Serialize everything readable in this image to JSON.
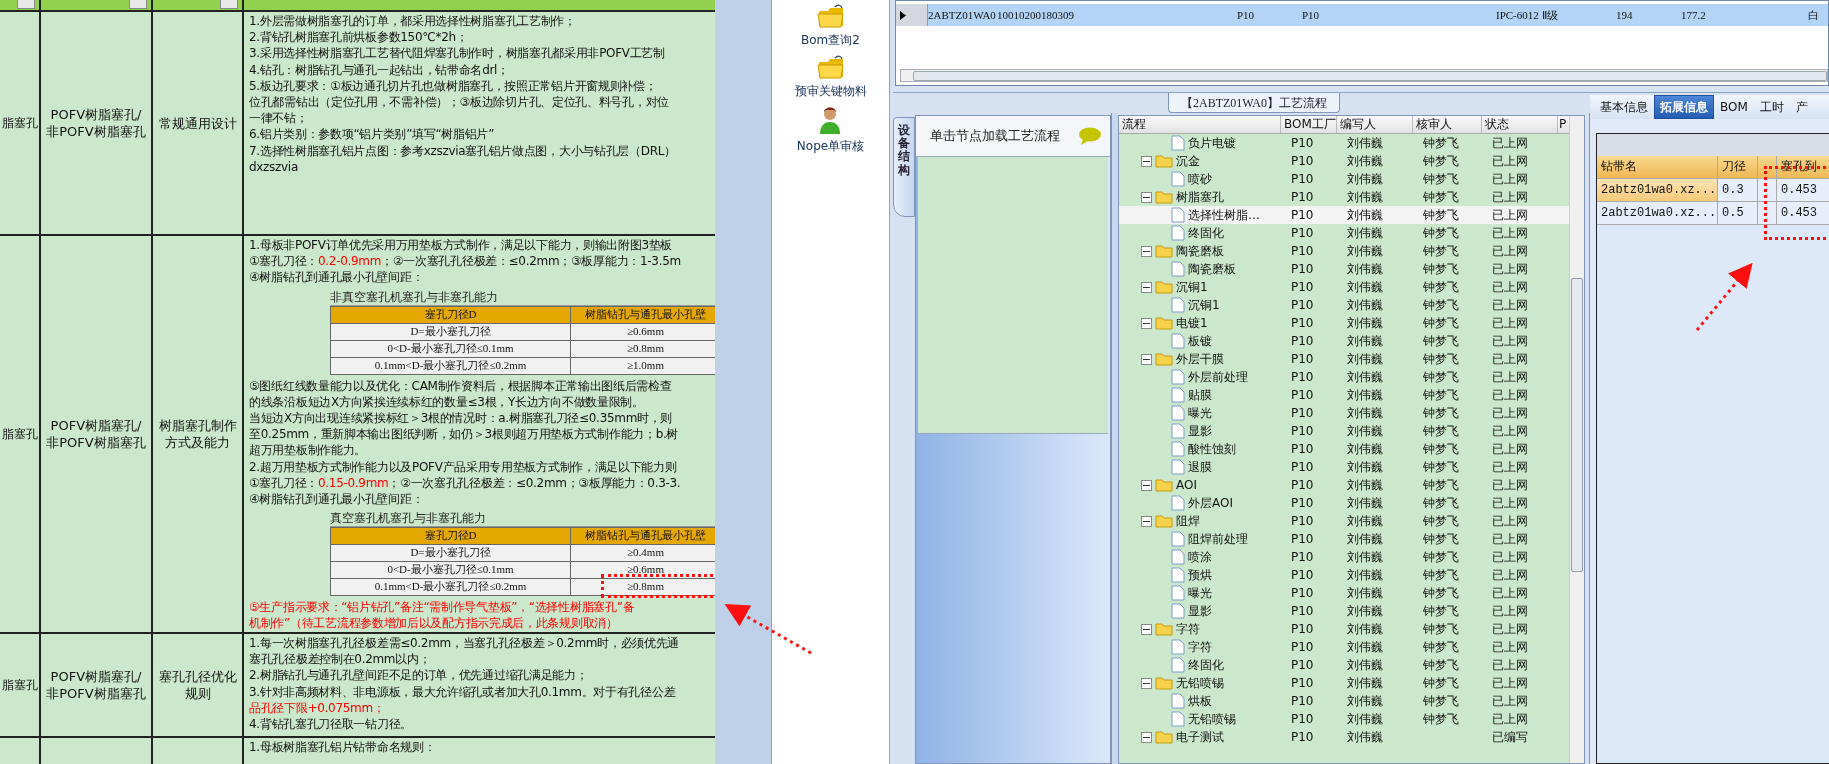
{
  "sheet": {
    "rows": [
      {
        "col1": "脂塞孔",
        "col2": "POFV树脂塞孔/非POFV树脂塞孔",
        "col3": "常规通用设计",
        "content": [
          {
            "kind": "line",
            "text": "1.外层需做树脂塞孔的订单，都采用选择性树脂塞孔工艺制作；",
            "red": false
          },
          {
            "kind": "line",
            "text": "2.背钻孔树脂塞孔前烘板参数150℃*2h；",
            "red": false
          },
          {
            "kind": "line",
            "text": "3.采用选择性树脂塞孔工艺替代阻焊塞孔制作时，树脂塞孔都采用非POFV工艺制",
            "red": false
          },
          {
            "kind": "line",
            "text": "4.钻孔：树脂钻孔与通孔一起钻出，钻带命名drl；",
            "red": false
          },
          {
            "kind": "line",
            "text": "5.板边孔要求：①板边通孔切片孔也做树脂塞孔，按照正常铝片开窗规则补偿；",
            "red": false
          },
          {
            "kind": "line",
            "text": "位孔都需钻出（定位孔用，不需补偿）；③板边除切片孔、定位孔、料号孔，对位",
            "red": false
          },
          {
            "kind": "line",
            "text": "一律不钻；",
            "red": false
          },
          {
            "kind": "line",
            "text": "6.铝片类别：参数项“铝片类别”填写“树脂铝片”",
            "red": false
          },
          {
            "kind": "line",
            "text": "7.选择性树脂塞孔铝片点图：参考xzszvia塞孔铝片做点图，大小与钻孔层（DRL）",
            "red": false
          },
          {
            "kind": "line",
            "text": "dxzszvia",
            "red": false
          }
        ]
      },
      {
        "col1": "脂塞孔",
        "col2": "POFV树脂塞孔/非POFV树脂塞孔",
        "col3": "树脂塞孔制作方式及能力",
        "content": [
          {
            "kind": "line",
            "text": "1.母板非POFV订单优先采用万用垫板方式制作，满足以下能力，则输出附图3垫板",
            "red": false
          },
          {
            "kind": "mixed",
            "parts": [
              {
                "text": "①塞孔刀径：",
                "red": false
              },
              {
                "text": "0.2-0.9mm",
                "red": true
              },
              {
                "text": "；②一次塞孔孔径极差：≤0.2mm；③板厚能力：1-3.5m",
                "red": false
              }
            ]
          },
          {
            "kind": "line",
            "text": "④树脂钻孔到通孔最小孔壁间距：",
            "red": false
          },
          {
            "kind": "table",
            "title": "非真空塞孔机塞孔与非塞孔能力",
            "header": [
              "塞孔刀径D",
              "树脂钻孔与通孔最小孔壁"
            ],
            "rows": [
              [
                "D=最小塞孔刀径",
                "≥0.6mm"
              ],
              [
                "0<D-最小塞孔刀径≤0.1mm",
                "≥0.8mm"
              ],
              [
                "0.1mm<D-最小塞孔刀径≤0.2mm",
                "≥1.0mm"
              ]
            ]
          },
          {
            "kind": "line",
            "text": "⑤图纸红线数量能力以及优化：CAM制作资料后，根据脚本正常输出图纸后需检查",
            "red": false
          },
          {
            "kind": "line",
            "text": "的线条沿板短边X方向紧挨连续标红的数量≤3根，Y长边方向不做数量限制。",
            "red": false
          },
          {
            "kind": "line",
            "text": "当短边X方向出现连续紧挨标红＞3根的情况时：a.树脂塞孔刀径≤0.35mm时，则",
            "red": false
          },
          {
            "kind": "line",
            "text": "至0.25mm，重新脚本输出图纸判断，如仍＞3根则超万用垫板方式制作能力；b.树",
            "red": false
          },
          {
            "kind": "line",
            "text": "超万用垫板制作能力。",
            "red": false
          },
          {
            "kind": "line",
            "text": "2.超万用垫板方式制作能力以及POFV产品采用专用垫板方式制作，满足以下能力则",
            "red": false
          },
          {
            "kind": "mixed",
            "parts": [
              {
                "text": "①塞孔刀径：",
                "red": false
              },
              {
                "text": "0.15-0.9mm",
                "red": true
              },
              {
                "text": "；②一次塞孔孔径极差：≤0.2mm；③板厚能力：0.3-3.",
                "red": false
              }
            ]
          },
          {
            "kind": "line",
            "text": "④树脂钻孔到通孔最小孔壁间距：",
            "red": false
          },
          {
            "kind": "table",
            "title": "真空塞孔机塞孔与非塞孔能力",
            "header": [
              "塞孔刀径D",
              "树脂钻孔与通孔最小孔壁"
            ],
            "rows": [
              [
                "D=最小塞孔刀径",
                "≥0.4mm"
              ],
              [
                "0<D-最小塞孔刀径≤0.1mm",
                "≥0.6mm"
              ],
              [
                "0.1mm<D-最小塞孔刀径≤0.2mm",
                "≥0.8mm"
              ]
            ]
          },
          {
            "kind": "line",
            "text": "⑤生产指示要求：“铝片钻孔”备注“需制作导气垫板”，“选择性树脂塞孔”备",
            "red": true
          },
          {
            "kind": "line",
            "text": "机制作”（待工艺流程参数增加后以及配方指示完成后，此条规则取消）",
            "red": true
          }
        ]
      },
      {
        "col1": "脂塞孔",
        "col2": "POFV树脂塞孔/非POFV树脂塞孔",
        "col3": "塞孔孔径优化规则",
        "content": [
          {
            "kind": "line",
            "text": "1.每一次树脂塞孔孔径极差需≤0.2mm，当塞孔孔径极差＞0.2mm时，必须优先通",
            "red": false
          },
          {
            "kind": "line",
            "text": "塞孔孔径极差控制在0.2mm以内；",
            "red": false
          },
          {
            "kind": "line",
            "text": "2.树脂钻孔与通孔孔壁间距不足的订单，优先通过缩孔满足能力；",
            "red": false
          },
          {
            "kind": "line",
            "text": "3.针对非高频材料、非电源板，最大允许缩孔或者加大孔0.1mm。对于有孔径公差",
            "red": false
          },
          {
            "kind": "line",
            "text": "品孔径下限+0.075mm；",
            "red": true
          },
          {
            "kind": "line",
            "text": "4.背钻孔塞孔刀径取一钻刀径。",
            "red": false
          }
        ]
      },
      {
        "content": [
          {
            "kind": "line",
            "text": "1.母板树脂塞孔铝片钻带命名规则：",
            "red": false
          }
        ]
      }
    ]
  },
  "launcher": [
    {
      "kind": "folder",
      "label": "Bom查询2"
    },
    {
      "kind": "folder",
      "label": "预审关键物料"
    },
    {
      "kind": "person",
      "label": "Nope单审核"
    }
  ],
  "order_grid": {
    "rows": [
      {
        "selected": true,
        "cells": [
          "2ABTZ01WA0",
          "10010200180309",
          null,
          null,
          "P10",
          "P10",
          null,
          null,
          null,
          "IPC-6012 Ⅱ级",
          "194",
          "177.2",
          null,
          "白"
        ]
      }
    ]
  },
  "process_tab": {
    "title": "【2ABTZ01WA0】工艺流程"
  },
  "device_panel": {
    "side_tab": "设备结构",
    "hint": "单击节点加载工艺流程"
  },
  "process_tree": {
    "columns": [
      "流程",
      "BOM工厂",
      "编写人",
      "核审人",
      "状态",
      "P"
    ],
    "nodes": [
      {
        "kind": "file",
        "name": "负片电镀",
        "plant": "P10",
        "writer": "刘伟巍",
        "reviewer": "钟梦飞",
        "status": "已上网",
        "selected": false
      },
      {
        "kind": "folder",
        "name": "沉金",
        "plant": "P10",
        "writer": "刘伟巍",
        "reviewer": "钟梦飞",
        "status": "已上网",
        "selected": false,
        "expanded": true,
        "children": [
          {
            "kind": "file",
            "name": "喷砂",
            "plant": "P10",
            "writer": "刘伟巍",
            "reviewer": "钟梦飞",
            "status": "已上网",
            "selected": false
          }
        ]
      },
      {
        "kind": "folder",
        "name": "树脂塞孔",
        "plant": "P10",
        "writer": "刘伟巍",
        "reviewer": "钟梦飞",
        "status": "已上网",
        "selected": false,
        "expanded": true,
        "children": [
          {
            "kind": "file",
            "name": "选择性树脂…",
            "plant": "P10",
            "writer": "刘伟巍",
            "reviewer": "钟梦飞",
            "status": "已上网",
            "selected": true
          },
          {
            "kind": "file",
            "name": "终固化",
            "plant": "P10",
            "writer": "刘伟巍",
            "reviewer": "钟梦飞",
            "status": "已上网",
            "selected": false
          }
        ]
      },
      {
        "kind": "folder",
        "name": "陶瓷磨板",
        "plant": "P10",
        "writer": "刘伟巍",
        "reviewer": "钟梦飞",
        "status": "已上网",
        "selected": false,
        "expanded": true,
        "children": [
          {
            "kind": "file",
            "name": "陶瓷磨板",
            "plant": "P10",
            "writer": "刘伟巍",
            "reviewer": "钟梦飞",
            "status": "已上网",
            "selected": false
          }
        ]
      },
      {
        "kind": "folder",
        "name": "沉铜1",
        "plant": "P10",
        "writer": "刘伟巍",
        "reviewer": "钟梦飞",
        "status": "已上网",
        "selected": false,
        "expanded": true,
        "children": [
          {
            "kind": "file",
            "name": "沉铜1",
            "plant": "P10",
            "writer": "刘伟巍",
            "reviewer": "钟梦飞",
            "status": "已上网",
            "selected": false
          }
        ]
      },
      {
        "kind": "folder",
        "name": "电镀1",
        "plant": "P10",
        "writer": "刘伟巍",
        "reviewer": "钟梦飞",
        "status": "已上网",
        "selected": false,
        "expanded": true,
        "children": [
          {
            "kind": "file",
            "name": "板镀",
            "plant": "P10",
            "writer": "刘伟巍",
            "reviewer": "钟梦飞",
            "status": "已上网",
            "selected": false
          }
        ]
      },
      {
        "kind": "folder",
        "name": "外层干膜",
        "plant": "P10",
        "writer": "刘伟巍",
        "reviewer": "钟梦飞",
        "status": "已上网",
        "selected": false,
        "expanded": true,
        "children": [
          {
            "kind": "file",
            "name": "外层前处理",
            "plant": "P10",
            "writer": "刘伟巍",
            "reviewer": "钟梦飞",
            "status": "已上网",
            "selected": false
          },
          {
            "kind": "file",
            "name": "贴膜",
            "plant": "P10",
            "writer": "刘伟巍",
            "reviewer": "钟梦飞",
            "status": "已上网",
            "selected": false
          },
          {
            "kind": "file",
            "name": "曝光",
            "plant": "P10",
            "writer": "刘伟巍",
            "reviewer": "钟梦飞",
            "status": "已上网",
            "selected": false
          },
          {
            "kind": "file",
            "name": "显影",
            "plant": "P10",
            "writer": "刘伟巍",
            "reviewer": "钟梦飞",
            "status": "已上网",
            "selected": false
          },
          {
            "kind": "file",
            "name": "酸性蚀刻",
            "plant": "P10",
            "writer": "刘伟巍",
            "reviewer": "钟梦飞",
            "status": "已上网",
            "selected": false
          },
          {
            "kind": "file",
            "name": "退膜",
            "plant": "P10",
            "writer": "刘伟巍",
            "reviewer": "钟梦飞",
            "status": "已上网",
            "selected": false
          }
        ]
      },
      {
        "kind": "folder",
        "name": "AOI",
        "plant": "P10",
        "writer": "刘伟巍",
        "reviewer": "钟梦飞",
        "status": "已上网",
        "selected": false,
        "expanded": true,
        "children": [
          {
            "kind": "file",
            "name": "外层AOI",
            "plant": "P10",
            "writer": "刘伟巍",
            "reviewer": "钟梦飞",
            "status": "已上网",
            "selected": false
          }
        ]
      },
      {
        "kind": "folder",
        "name": "阻焊",
        "plant": "P10",
        "writer": "刘伟巍",
        "reviewer": "钟梦飞",
        "status": "已上网",
        "selected": false,
        "expanded": true,
        "children": [
          {
            "kind": "file",
            "name": "阻焊前处理",
            "plant": "P10",
            "writer": "刘伟巍",
            "reviewer": "钟梦飞",
            "status": "已上网",
            "selected": false
          },
          {
            "kind": "file",
            "name": "喷涂",
            "plant": "P10",
            "writer": "刘伟巍",
            "reviewer": "钟梦飞",
            "status": "已上网",
            "selected": false
          },
          {
            "kind": "file",
            "name": "预烘",
            "plant": "P10",
            "writer": "刘伟巍",
            "reviewer": "钟梦飞",
            "status": "已上网",
            "selected": false
          },
          {
            "kind": "file",
            "name": "曝光",
            "plant": "P10",
            "writer": "刘伟巍",
            "reviewer": "钟梦飞",
            "status": "已上网",
            "selected": false
          },
          {
            "kind": "file",
            "name": "显影",
            "plant": "P10",
            "writer": "刘伟巍",
            "reviewer": "钟梦飞",
            "status": "已上网",
            "selected": false
          }
        ]
      },
      {
        "kind": "folder",
        "name": "字符",
        "plant": "P10",
        "writer": "刘伟巍",
        "reviewer": "钟梦飞",
        "status": "已上网",
        "selected": false,
        "expanded": true,
        "children": [
          {
            "kind": "file",
            "name": "字符",
            "plant": "P10",
            "writer": "刘伟巍",
            "reviewer": "钟梦飞",
            "status": "已上网",
            "selected": false
          },
          {
            "kind": "file",
            "name": "终固化",
            "plant": "P10",
            "writer": "刘伟巍",
            "reviewer": "钟梦飞",
            "status": "已上网",
            "selected": false
          }
        ]
      },
      {
        "kind": "folder",
        "name": "无铅喷锡",
        "plant": "P10",
        "writer": "刘伟巍",
        "reviewer": "钟梦飞",
        "status": "已上网",
        "selected": false,
        "expanded": true,
        "children": [
          {
            "kind": "file",
            "name": "烘板",
            "plant": "P10",
            "writer": "刘伟巍",
            "reviewer": "钟梦飞",
            "status": "已上网",
            "selected": false
          },
          {
            "kind": "file",
            "name": "无铅喷锡",
            "plant": "P10",
            "writer": "刘伟巍",
            "reviewer": "钟梦飞",
            "status": "已上网",
            "selected": false
          }
        ]
      },
      {
        "kind": "folder",
        "name": "电子测试",
        "plant": "P10",
        "writer": "刘伟巍",
        "status": "已编写",
        "selected": false,
        "expanded": true
      }
    ]
  },
  "detail_panel": {
    "tabs": [
      {
        "label": "基本信息",
        "selected": false
      },
      {
        "label": "拓展信息",
        "selected": true
      },
      {
        "label": "BOM",
        "selected": false
      },
      {
        "label": "工时",
        "selected": false
      },
      {
        "label": "产",
        "selected": false
      }
    ],
    "drill_grid": {
      "columns": [
        "钻带名",
        "刀径",
        null,
        "塞孔到"
      ],
      "rows": [
        {
          "selected": true,
          "cells": [
            "2abtz01wa0.xz...",
            "0.3",
            null,
            "0.453"
          ]
        },
        {
          "selected": false,
          "cells": [
            "2abtz01wa0.xz...",
            "0.5",
            null,
            "0.453"
          ]
        }
      ]
    }
  }
}
